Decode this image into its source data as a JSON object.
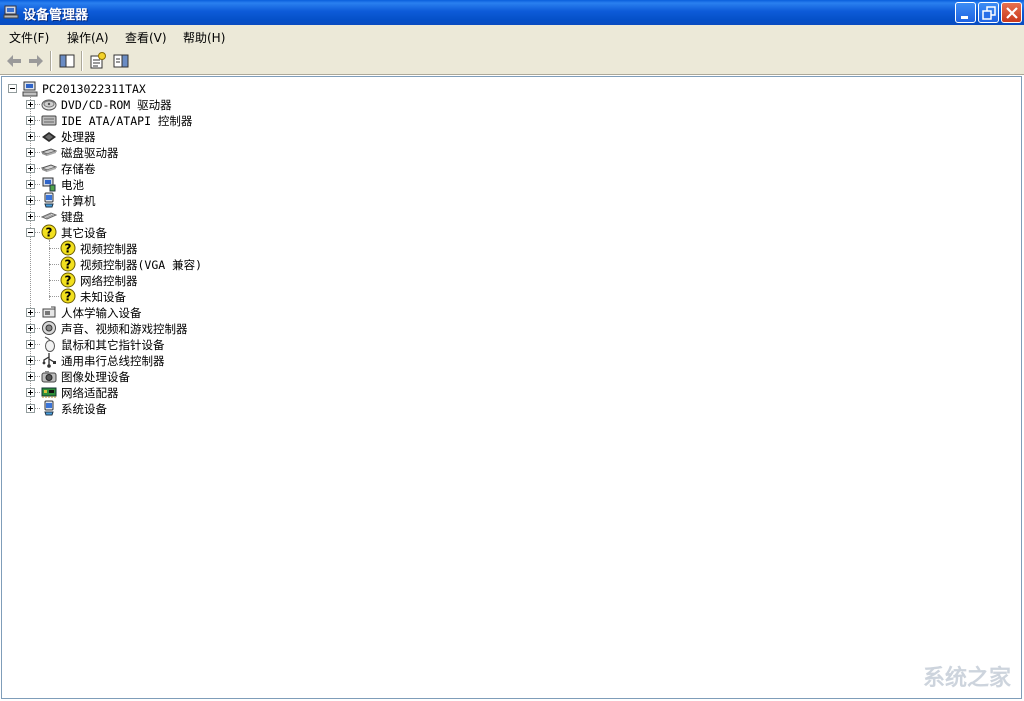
{
  "window": {
    "title": "设备管理器"
  },
  "menu": {
    "file": "文件(F)",
    "action": "操作(A)",
    "view": "查看(V)",
    "help": "帮助(H)"
  },
  "toolbar": {
    "back_icon": "back-arrow-icon",
    "forward_icon": "forward-arrow-icon",
    "show_hide_tree_icon": "show-hide-tree-icon",
    "properties_icon": "properties-icon",
    "help_icon": "help-pane-icon"
  },
  "tree": {
    "root": "PC2013022311TAX",
    "items": [
      {
        "label": "DVD/CD-ROM 驱动器",
        "icon": "cdrom-icon"
      },
      {
        "label": "IDE ATA/ATAPI 控制器",
        "icon": "ide-controller-icon"
      },
      {
        "label": "处理器",
        "icon": "processor-icon"
      },
      {
        "label": "磁盘驱动器",
        "icon": "disk-drive-icon"
      },
      {
        "label": "存储卷",
        "icon": "storage-volume-icon"
      },
      {
        "label": "电池",
        "icon": "battery-icon"
      },
      {
        "label": "计算机",
        "icon": "computer-icon"
      },
      {
        "label": "键盘",
        "icon": "keyboard-icon"
      },
      {
        "label": "其它设备",
        "icon": "unknown-device-icon",
        "expanded": true,
        "children": [
          {
            "label": "视频控制器",
            "icon": "unknown-device-icon"
          },
          {
            "label": "视频控制器(VGA 兼容)",
            "icon": "unknown-device-icon"
          },
          {
            "label": "网络控制器",
            "icon": "unknown-device-icon"
          },
          {
            "label": "未知设备",
            "icon": "unknown-device-icon"
          }
        ]
      },
      {
        "label": "人体学输入设备",
        "icon": "hid-icon"
      },
      {
        "label": "声音、视频和游戏控制器",
        "icon": "sound-icon"
      },
      {
        "label": "鼠标和其它指针设备",
        "icon": "mouse-icon"
      },
      {
        "label": "通用串行总线控制器",
        "icon": "usb-icon"
      },
      {
        "label": "图像处理设备",
        "icon": "imaging-icon"
      },
      {
        "label": "网络适配器",
        "icon": "network-adapter-icon"
      },
      {
        "label": "系统设备",
        "icon": "system-device-icon"
      }
    ]
  },
  "watermark": "系统之家",
  "colors": {
    "titlebar": "#0a5fdc",
    "chrome": "#ece9d8",
    "warning_yellow": "#f2e01e"
  }
}
